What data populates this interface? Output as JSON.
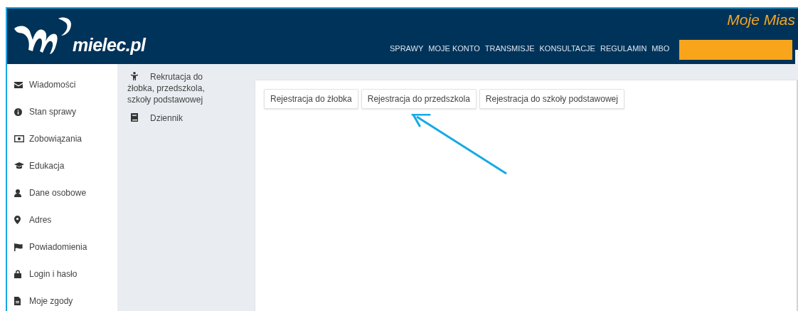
{
  "header": {
    "logo_text": "mielec.pl",
    "site_title": "Moje Mias",
    "nav": [
      "SPRAWY",
      "MOJE KONTO",
      "TRANSMISJE",
      "KONSULTACJE",
      "REGULAMIN",
      "MBO"
    ]
  },
  "sidebar": {
    "items": [
      "Wiadomości",
      "Stan sprawy",
      "Zobowiązania",
      "Edukacja",
      "Dane osobowe",
      "Adres",
      "Powiadomienia",
      "Login i hasło",
      "Moje zgody"
    ]
  },
  "submenu": {
    "items": [
      "Rekrutacja do żłobka, przedszkola, szkoły podstawowej",
      "Dziennik"
    ]
  },
  "content": {
    "buttons": [
      "Rejestracja do żłobka",
      "Rejestracja do przedszkola",
      "Rejestracja do szkoły podstawowej"
    ]
  }
}
